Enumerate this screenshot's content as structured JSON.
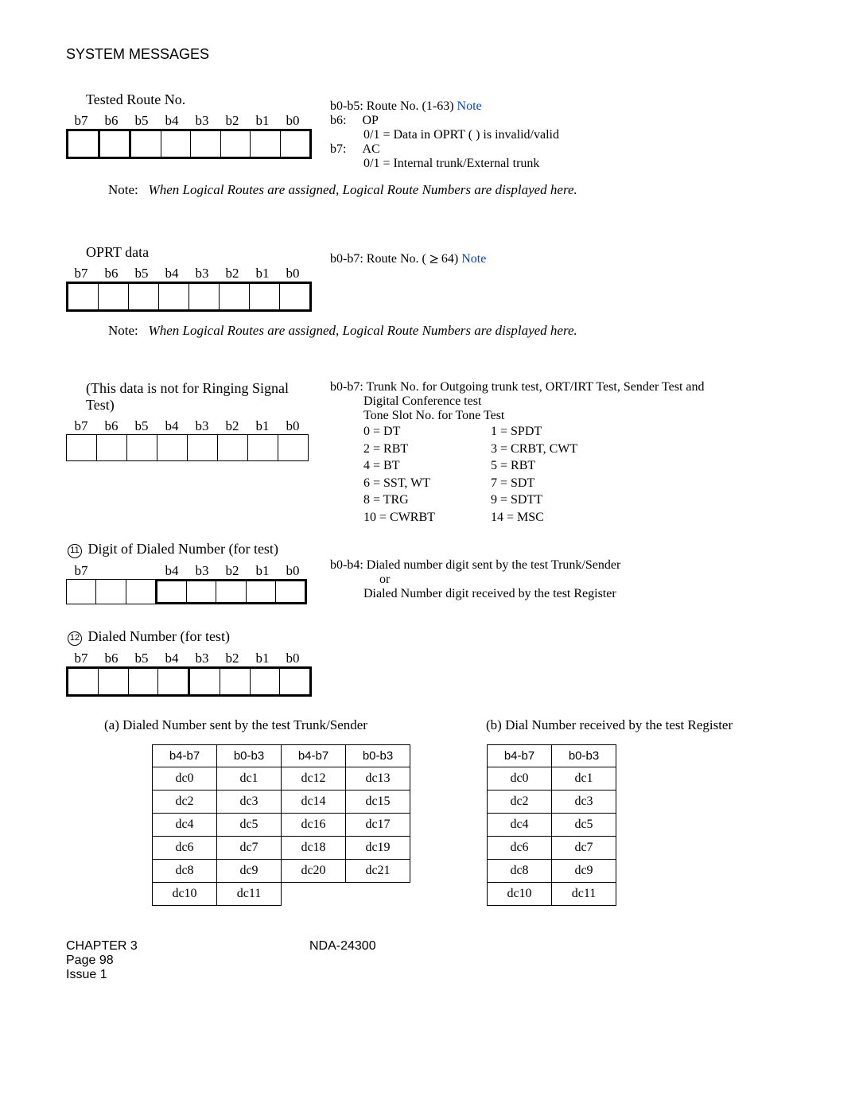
{
  "header": "SYSTEM MESSAGES",
  "bits": {
    "b7": "b7",
    "b6": "b6",
    "b5": "b5",
    "b4": "b4",
    "b3": "b3",
    "b2": "b2",
    "b1": "b1",
    "b0": "b0"
  },
  "sec1": {
    "title": "Tested Route No.",
    "r1a": "b0-b5:",
    "r1b": "Route No. (1-63)",
    "r1c": "Note",
    "r2a": "b6:",
    "r2b": "OP",
    "r3": "0/1 = Data in OPRT (       ) is invalid/valid",
    "r4a": "b7:",
    "r4b": "AC",
    "r5": "0/1 = Internal trunk/External trunk"
  },
  "note_common_label": "Note:",
  "note_common_text": "When Logical Routes are assigned, Logical Route Numbers are displayed here.",
  "sec2": {
    "title": "OPRT data",
    "r1a": "b0-b7:",
    "r1b": "Route No. (",
    "r1c": "64)",
    "r1d": "Note"
  },
  "sec3": {
    "title": "(This data is not for Ringing Signal Test)",
    "r1a": "b0-b7:",
    "r1b": "Trunk No. for Outgoing trunk test, ORT/IRT Test, Sender Test and",
    "r1c": "Digital Conference test",
    "r2": "Tone Slot No. for Tone Test",
    "t0a": "0 = DT",
    "t0b": "1 = SPDT",
    "t1a": "2 = RBT",
    "t1b": "3 = CRBT, CWT",
    "t2a": "4 = BT",
    "t2b": "5 = RBT",
    "t3a": "6 = SST, WT",
    "t3b": "7 = SDT",
    "t4a": "8 = TRG",
    "t4b": "9 = SDTT",
    "t5a": "10 = CWRBT",
    "t5b": "14 = MSC"
  },
  "sec4": {
    "num": "11",
    "title": "Digit of Dialed Number (for test)",
    "r1a": "b0-b4:",
    "r1b": "Dialed number digit sent by the test Trunk/Sender",
    "r2": "or",
    "r3": "Dialed Number digit received by the test Register"
  },
  "sec5": {
    "num": "12",
    "title": "Dialed Number (for test)"
  },
  "part_a_label": "(a)   Dialed Number sent by the test Trunk/Sender",
  "part_b_label": "(b)   Dial Number received by the test Register",
  "t_hdr": {
    "c1": "b4-b7",
    "c2": "b0-b3",
    "c3": "b4-b7",
    "c4": "b0-b3"
  },
  "ta": [
    [
      "dc0",
      "dc1",
      "dc12",
      "dc13"
    ],
    [
      "dc2",
      "dc3",
      "dc14",
      "dc15"
    ],
    [
      "dc4",
      "dc5",
      "dc16",
      "dc17"
    ],
    [
      "dc6",
      "dc7",
      "dc18",
      "dc19"
    ],
    [
      "dc8",
      "dc9",
      "dc20",
      "dc21"
    ],
    [
      "dc10",
      "dc11",
      "",
      ""
    ]
  ],
  "tb": [
    [
      "dc0",
      "dc1"
    ],
    [
      "dc2",
      "dc3"
    ],
    [
      "dc4",
      "dc5"
    ],
    [
      "dc6",
      "dc7"
    ],
    [
      "dc8",
      "dc9"
    ],
    [
      "dc10",
      "dc11"
    ]
  ],
  "footer": {
    "chapter": "CHAPTER 3",
    "page": "Page 98",
    "issue": "Issue 1",
    "doc": "NDA-24300"
  }
}
